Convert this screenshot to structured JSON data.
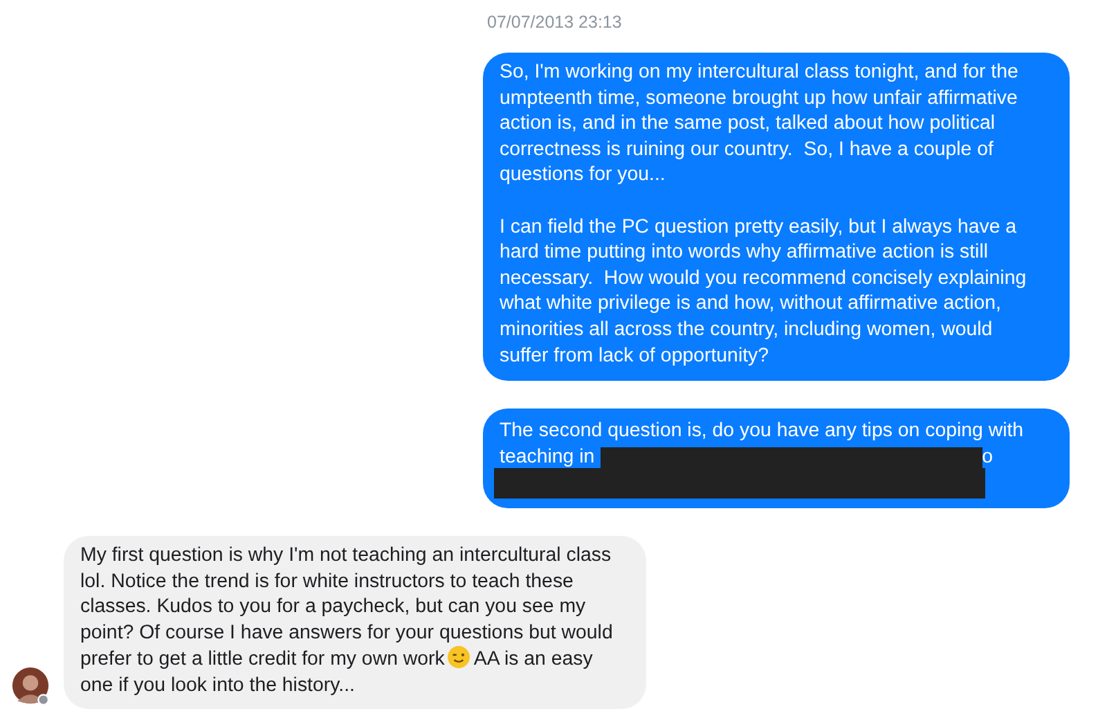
{
  "timestamp": "07/07/2013 23:13",
  "messages": [
    {
      "kind": "outgoing",
      "paragraphs": [
        "So, I'm working on my intercultural class tonight, and for the umpteenth time, someone brought up how unfair affirmative action is, and in the same post, talked about how political correctness is ruining our country.  So, I have a couple of questions for you...",
        "I can field the PC question pretty easily, but I always have a hard time putting into words why affirmative action is still necessary.  How would you recommend concisely explaining what white privilege is and how, without affirmative action, minorities all across the country, including women, would suffer from lack of opportunity?"
      ]
    },
    {
      "kind": "redacted",
      "lines": [
        {
          "text": "The second question is, do you have any tips on coping with"
        },
        {
          "text": "teaching in",
          "tail": "o"
        }
      ]
    },
    {
      "kind": "incoming",
      "text_before": "My first question is why I'm not teaching an intercultural class lol. Notice the trend is for white instructors to teach these classes. Kudos to you for a paycheck, but can you see my point? Of course I have answers for your questions but would prefer to get a little credit for my own work",
      "text_after": "AA is an easy one if you look into the history..."
    }
  ]
}
